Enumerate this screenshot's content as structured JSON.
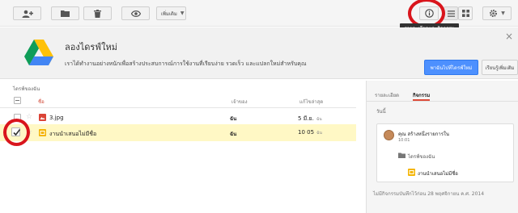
{
  "toolbar": {
    "more_label": "เพิ่มเติม",
    "details_tooltip": "รายละเอียดและกิจกรรม"
  },
  "promo": {
    "title": "ลองไดรฟ์ใหม่",
    "description": "เราได้ทำงานอย่างหนักเพื่อสร้างประสบการณ์การใช้งานที่เรียบง่าย รวดเร็ว และแปลกใหม่สำหรับคุณ",
    "primary_button": "พาฉันไปที่ไดรฟ์ใหม่",
    "secondary_button": "เรียนรู้เพิ่มเติม"
  },
  "file_list": {
    "breadcrumb": "ไดรฟ์ของฉัน",
    "columns": {
      "name": "ชื่อ",
      "owner": "เจ้าของ",
      "modified": "แก้ไขล่าสุด"
    },
    "rows": [
      {
        "name": "3.jpg",
        "owner": "ฉัน",
        "modified": "5 มี.ย.",
        "modified_by": "ฉัน",
        "selected": false,
        "icon": "image-icon"
      },
      {
        "name": "งานนำเสนอไม่มีชื่อ",
        "owner": "ฉัน",
        "modified": "10 05",
        "modified_by": "ฉัน",
        "selected": true,
        "icon": "slides-icon"
      }
    ]
  },
  "details_panel": {
    "tabs": [
      "รายละเอียด",
      "กิจกรรม"
    ],
    "active_tab": "กิจกรรม",
    "today_label": "วันนี้",
    "activity": {
      "actor_line": "คุณ สร้างหนึ่งรายการใน",
      "time": "10:01",
      "folder": "ไดรฟ์ของฉัน",
      "file": "งานนำเสนอไม่มีชื่อ"
    },
    "footer": "ไม่มีกิจกรรมบันทึกไว้ก่อน 28 พฤศจิกายน ค.ศ. 2014"
  },
  "colors": {
    "accent_red": "#d9151c",
    "selected_row": "#fff8c5",
    "primary_blue": "#4d90fe",
    "slides_yellow": "#f4b400",
    "image_red": "#db4437"
  }
}
